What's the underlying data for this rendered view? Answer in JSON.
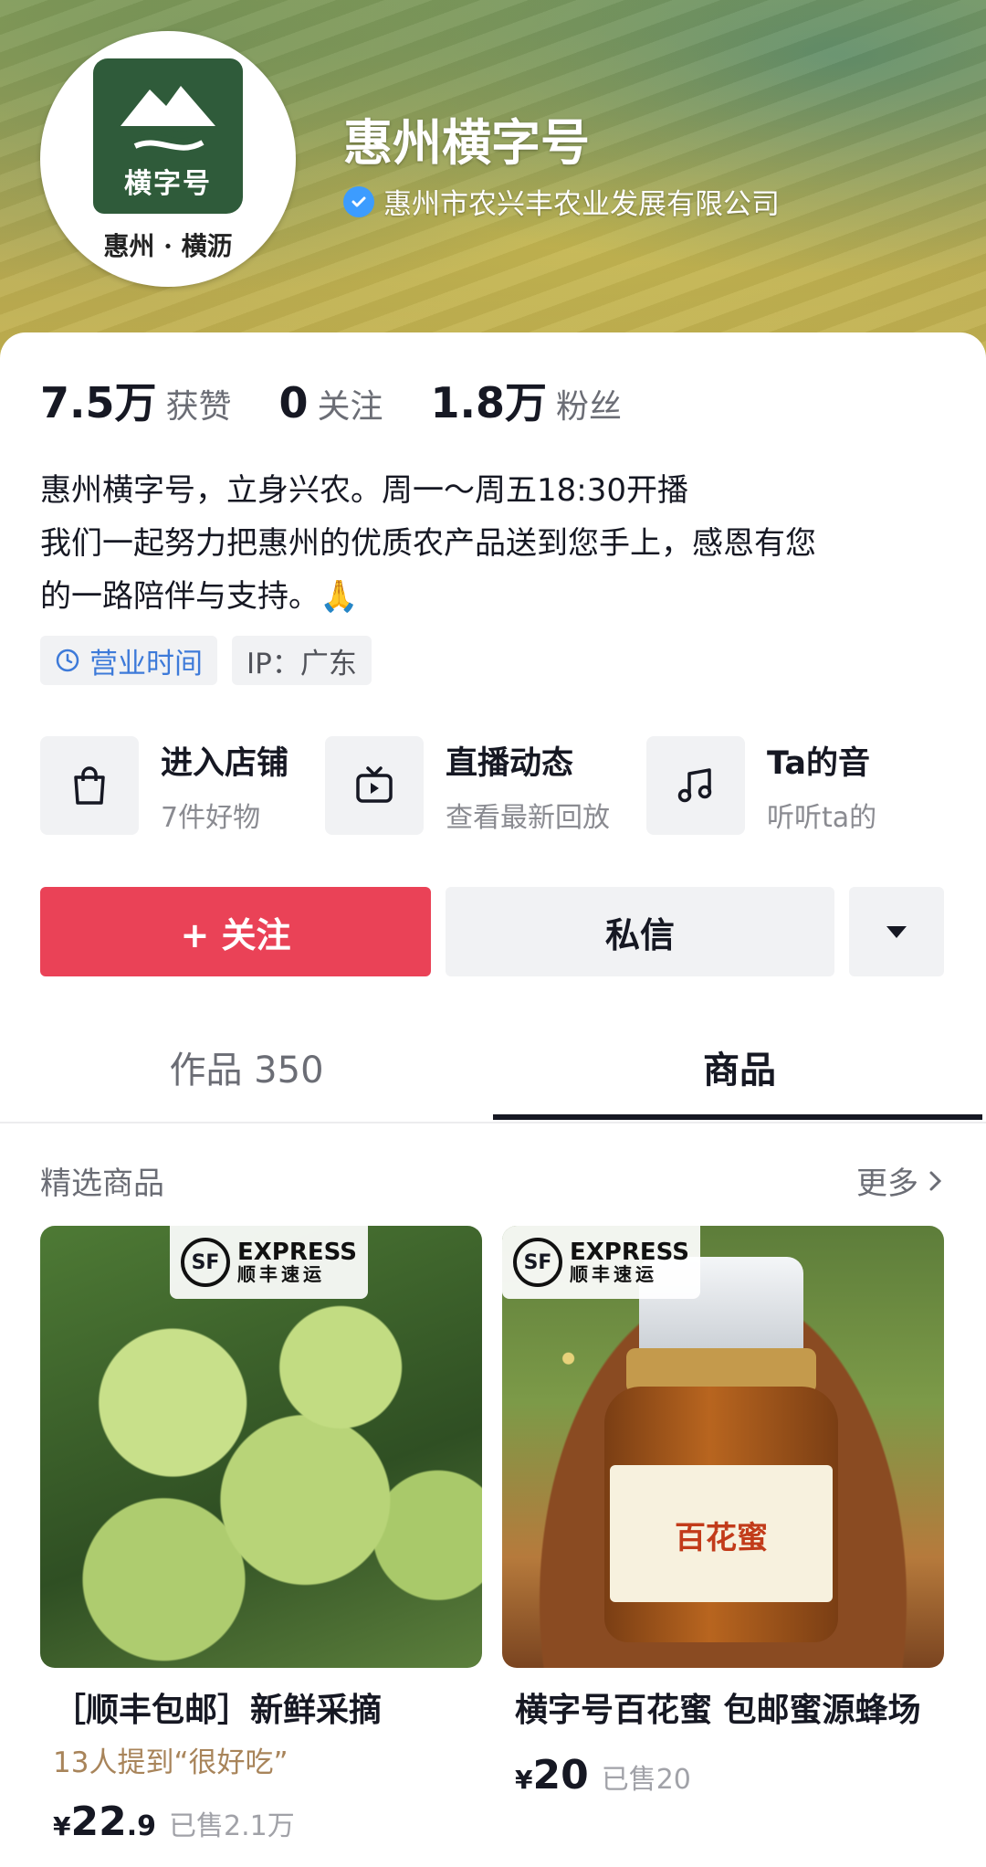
{
  "profile": {
    "name": "惠州横字号",
    "verified_org": "惠州市农兴丰农业发展有限公司",
    "avatar_logo_text": "横字号",
    "avatar_caption": "惠州 · 横沥"
  },
  "stats": [
    {
      "value": "7.5万",
      "label": "获赞"
    },
    {
      "value": "0",
      "label": "关注"
    },
    {
      "value": "1.8万",
      "label": "粉丝"
    }
  ],
  "bio": {
    "line1": "惠州横字号，立身兴农。周一～周五18:30开播",
    "line2": "我们一起努力把惠州的优质农产品送到您手上，感恩有您",
    "line3": "的一路陪伴与支持。🙏"
  },
  "tags": {
    "hours": "营业时间",
    "ip": "IP：广东"
  },
  "entries": [
    {
      "title": "进入店铺",
      "sub": "7件好物",
      "icon": "shopping-bag-icon"
    },
    {
      "title": "直播动态",
      "sub": "查看最新回放",
      "icon": "tv-icon"
    },
    {
      "title": "Ta的音",
      "sub": "听听ta的",
      "icon": "music-note-icon"
    }
  ],
  "actions": {
    "follow": "+ 关注",
    "message": "私信"
  },
  "tabs": {
    "works": "作品 350",
    "goods": "商品"
  },
  "section": {
    "title": "精选商品",
    "more": "更多"
  },
  "products": [
    {
      "title": "［顺丰包邮］新鲜采摘",
      "hint": "13人提到“很好吃”",
      "price_symbol": "¥",
      "price_int": "22",
      "price_dec": ".9",
      "sold": "已售2.1万",
      "badge_en": "EXPRESS",
      "badge_cn": "顺丰速运",
      "badge_logo": "SF"
    },
    {
      "title": "横字号百花蜜  包邮蜜源蜂场",
      "price_symbol": "¥",
      "price_int": "20",
      "price_dec": "",
      "sold": "已售20",
      "badge_en": "EXPRESS",
      "badge_cn": "顺丰速运",
      "badge_logo": "SF",
      "jar_label": "百花蜜"
    }
  ],
  "colors": {
    "follow_button": "#ea4257",
    "verify_badge": "#3c9cff",
    "tag_hours": "#3d7ad9",
    "hint_text": "#a8845a"
  }
}
